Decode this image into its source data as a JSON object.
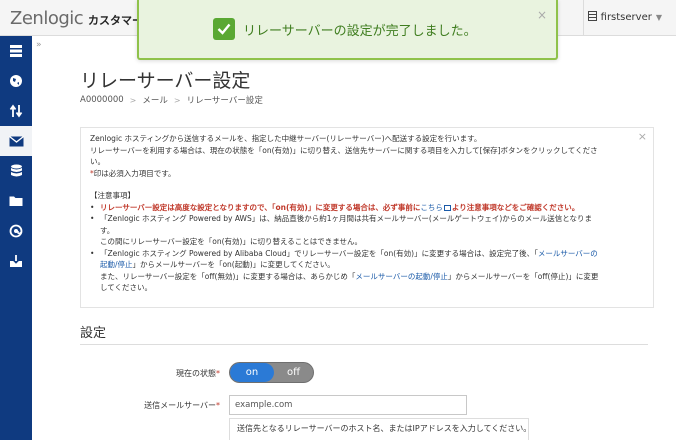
{
  "header": {
    "logo": "Zenlogic",
    "logo_sub": "カスタマー",
    "user": "firstserver"
  },
  "toast": {
    "message": "リレーサーバーの設定が完了しました。",
    "close": "×"
  },
  "sidebar": {
    "collapse": "»",
    "items": [
      {
        "icon": "server-icon"
      },
      {
        "icon": "globe-icon"
      },
      {
        "icon": "transfer-arrows-icon"
      },
      {
        "icon": "mail-icon",
        "active": true
      },
      {
        "icon": "database-icon"
      },
      {
        "icon": "folder-icon"
      },
      {
        "icon": "at-sign-icon"
      },
      {
        "icon": "download-box-icon"
      }
    ]
  },
  "page": {
    "title": "リレーサーバー設定",
    "breadcrumb": [
      "A0000000",
      "メール",
      "リレーサーバー設定"
    ]
  },
  "notice": {
    "close": "×",
    "line1": "Zenlogic ホスティングから送信するメールを、指定した中継サーバー(リレーサーバー)へ配送する設定を行います。",
    "line2": "リレーサーバーを利用する場合は、現在の状態を「on(有効)」に切り替え、送信先サーバーに関する項目を入力して[保存]ボタンをクリックしてくださ",
    "line3": "い。",
    "required_mark": "*",
    "required_text": "印は必須入力項目です。",
    "caution_title": "【注意事項】",
    "b1_text": "リレーサーバー設定は高度な設定となりますので、「on(有効)」に変更する場合は、必ず事前に",
    "b1_link": "こちら",
    "b1_after": "より注意事項などをご確認ください。",
    "b2_line1": "「Zenlogic ホスティング Powered by AWS」は、納品直後から約1ヶ月間は共有メールサーバー(メールゲートウェイ)からのメール送信となりま",
    "b2_line2": "す。",
    "b2_line3": "この間にリレーサーバー設定を「on(有効)」に切り替えることはできません。",
    "b3_line1_pre": "「Zenlogic ホスティング Powered by Alibaba Cloud」でリレーサーバー設定を「on(有効)」に変更する場合は、設定完了後、「",
    "b3_link1a": "メールサーバーの",
    "b3_link1b": "起動/停止",
    "b3_line2_post": "」からメールサーバーを「on(起動)」に変更してください。",
    "b3_line3_pre": "また、リレーサーバー設定を「off(無効)」に変更する場合は、あらかじめ「",
    "b3_link2": "メールサーバーの起動/停止",
    "b3_line3_post": "」からメールサーバーを「off(停止)」に変更",
    "b3_line4": "してください。"
  },
  "section": {
    "title": "設定"
  },
  "form": {
    "status_label": "現在の状態",
    "toggle_on": "on",
    "toggle_off": "off",
    "server_label": "送信メールサーバー",
    "required_mark": "*",
    "server_value": "example.com",
    "server_hint": "送信先となるリレーサーバーのホスト名、またはIPアドレスを入力してください。"
  }
}
